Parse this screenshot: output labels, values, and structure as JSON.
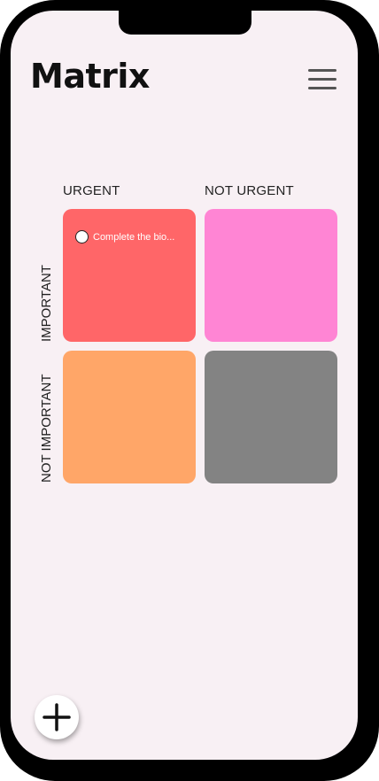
{
  "app": {
    "title": "Matrix"
  },
  "matrix": {
    "columns": [
      "URGENT",
      "NOT URGENT"
    ],
    "rows": [
      "IMPORTANT",
      "NOT IMPORTANT"
    ],
    "quadrants": [
      {
        "color": "#ff6668",
        "tasks": [
          "Complete the bio..."
        ]
      },
      {
        "color": "#ff85d4",
        "tasks": []
      },
      {
        "color": "#ffa668",
        "tasks": []
      },
      {
        "color": "#838383",
        "tasks": []
      }
    ]
  },
  "icons": {
    "menu": "hamburger-menu-icon",
    "add": "plus-icon"
  },
  "colors": {
    "screen_background": "#f8f0f4",
    "phone_frame": "#000000"
  }
}
